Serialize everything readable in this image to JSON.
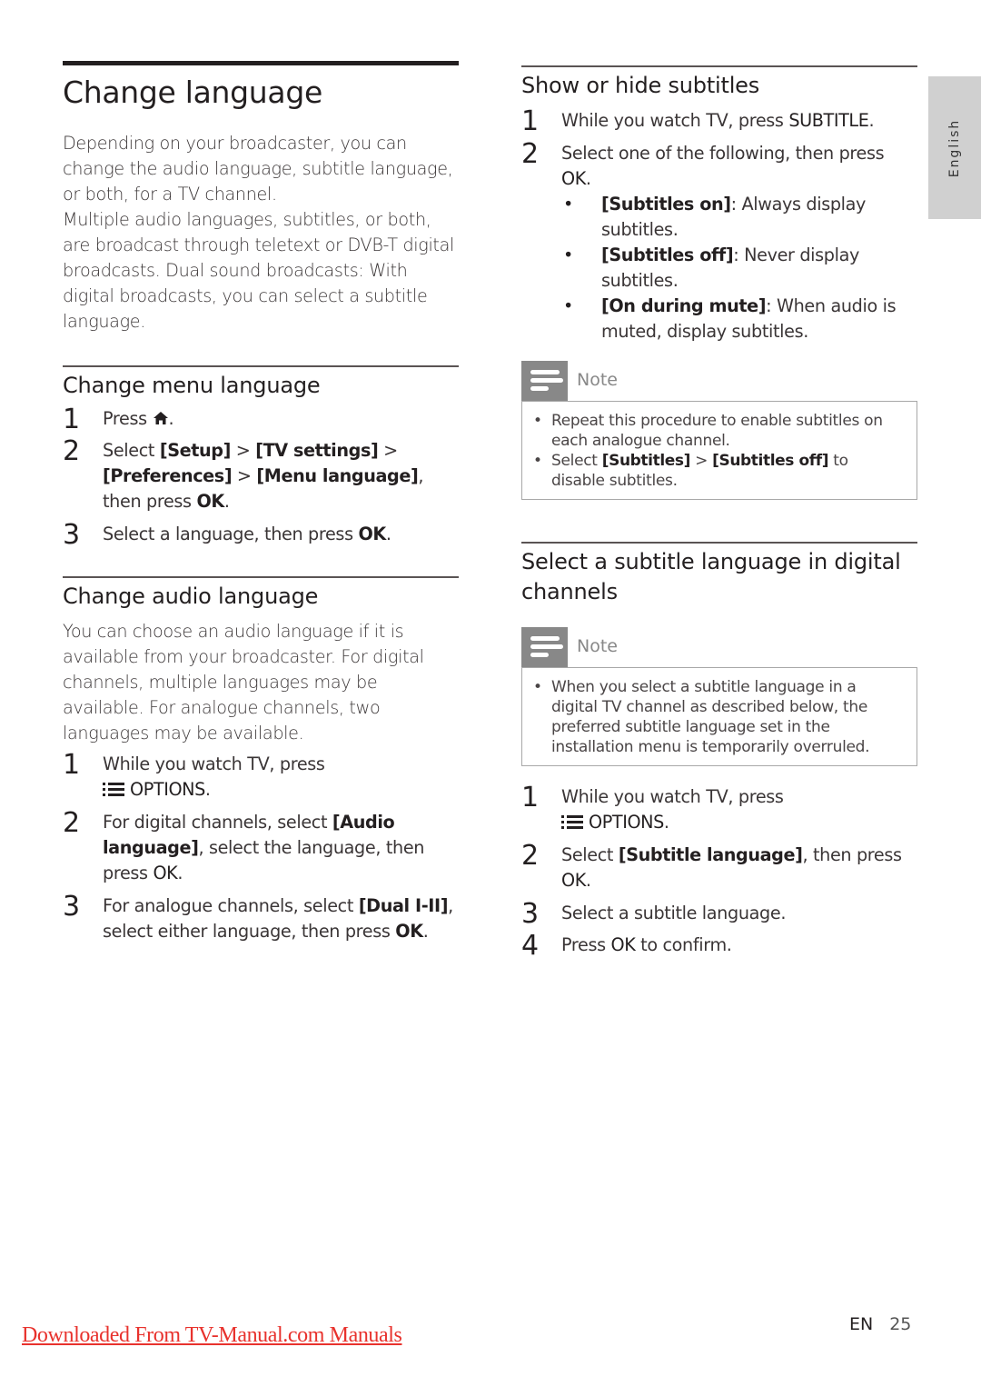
{
  "side_tab": {
    "label": "English"
  },
  "left": {
    "title": "Change language",
    "intro": [
      "Depending on your broadcaster, you can change the audio language, subtitle language, or both, for a TV channel.",
      "Multiple audio languages, subtitles, or both, are broadcast through teletext or DVB-T digital broadcasts. Dual sound broadcasts: With digital broadcasts, you can select a subtitle language."
    ],
    "menu_language": {
      "heading": "Change menu language",
      "steps": [
        {
          "num": "1",
          "text": "Press",
          "icon": "home-icon",
          "end": "."
        },
        {
          "num": "2",
          "pre": "Select ",
          "b1": "[Setup]",
          "s1": " > ",
          "b2": "[TV settings]",
          "s2": " > ",
          "b3": "[Preferences]",
          "s3": " > ",
          "b4": "[Menu language]",
          "s4": ", then press ",
          "b5": "OK",
          "end": "."
        },
        {
          "num": "3",
          "pre": "Select a language, then press ",
          "b1": "OK",
          "end": "."
        }
      ]
    },
    "audio_language": {
      "heading": "Change audio language",
      "body": "You can choose an audio language if it is available from your broadcaster. For digital channels, multiple languages may be available. For analogue channels, two languages may be available.",
      "steps": [
        {
          "num": "1",
          "pre": "While you watch TV, press",
          "icon": "options-icon",
          "b1": "OPTIONS",
          "end": "."
        },
        {
          "num": "2",
          "pre": "For digital channels, select ",
          "b1": "[Audio language]",
          "mid": ", select the language, then press ",
          "b2": "OK",
          "end": "."
        },
        {
          "num": "3",
          "pre": "For analogue channels, select ",
          "b1": "[Dual I-II]",
          "mid": ", select either language, then press ",
          "b2": "OK",
          "end": "."
        }
      ]
    }
  },
  "right": {
    "show_hide": {
      "heading": "Show or hide subtitles",
      "steps": [
        {
          "num": "1",
          "pre": "While you watch TV, press ",
          "b1": "SUBTITLE",
          "end": "."
        },
        {
          "num": "2",
          "pre": "Select one of the following, then press ",
          "b1": "OK",
          "end": "."
        }
      ],
      "options": [
        {
          "b": "[Subtitles on]",
          "text": ": Always display subtitles."
        },
        {
          "b": "[Subtitles off]",
          "text": ": Never display subtitles."
        },
        {
          "b": "[On during mute]",
          "text": ": When audio is muted, display subtitles."
        }
      ],
      "note": {
        "label": "Note",
        "items": [
          {
            "text": "Repeat this procedure to enable subtitles on each analogue channel."
          },
          {
            "pre": "Select ",
            "b1": "[Subtitles]",
            "mid": " > ",
            "b2": "[Subtitles off]",
            "end": " to disable subtitles."
          }
        ]
      }
    },
    "digital": {
      "heading": "Select a subtitle language in digital channels",
      "note": {
        "label": "Note",
        "items": [
          {
            "text": "When you select a subtitle language in a digital TV channel as described below, the preferred subtitle language set in the installation menu is temporarily overruled."
          }
        ]
      },
      "steps": [
        {
          "num": "1",
          "pre": "While you watch TV, press",
          "icon": "options-icon",
          "b1": "OPTIONS",
          "end": "."
        },
        {
          "num": "2",
          "pre": "Select ",
          "b1": "[Subtitle language]",
          "mid": ", then press ",
          "b2": "OK",
          "end": "."
        },
        {
          "num": "3",
          "pre": "Select a subtitle language."
        },
        {
          "num": "4",
          "pre": "Press ",
          "b1": "OK",
          "mid": " to confirm."
        }
      ]
    }
  },
  "footer": {
    "link_text": "Downloaded From TV-Manual.com Manuals",
    "lang_code": "EN",
    "page_number": "25",
    "link_color": "#e8322d"
  }
}
